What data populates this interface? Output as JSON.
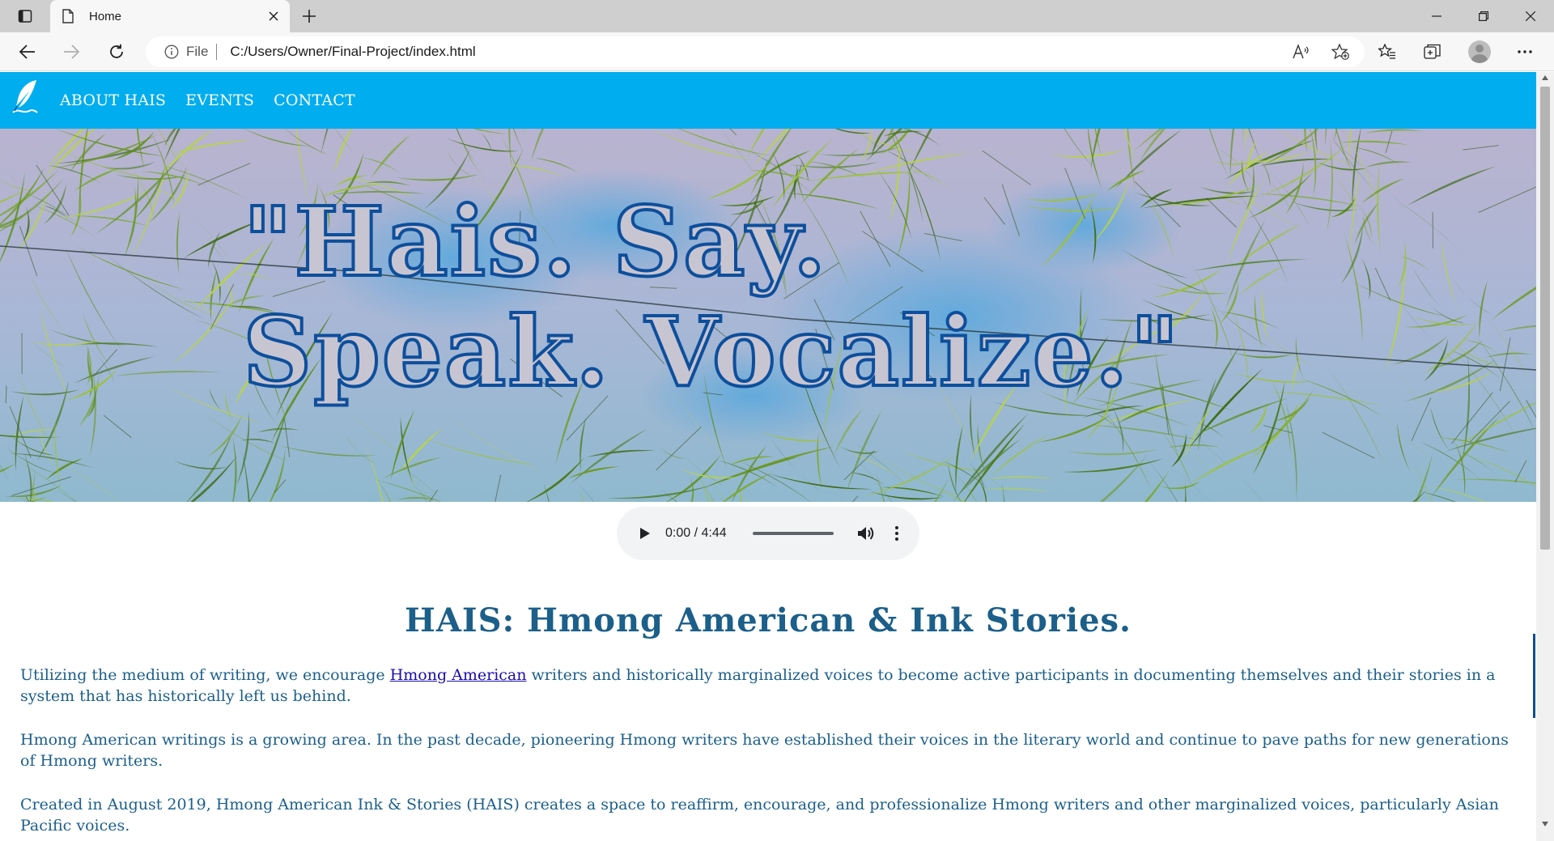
{
  "browser": {
    "tab": {
      "title": "Home"
    },
    "address": {
      "scheme_label": "File",
      "url": "C:/Users/Owner/Final-Project/index.html"
    }
  },
  "site": {
    "nav": {
      "items": [
        {
          "label": "ABOUT HAIS"
        },
        {
          "label": "EVENTS"
        },
        {
          "label": "CONTACT"
        }
      ]
    },
    "hero": {
      "quote": "\"Hais. Say.\nSpeak. Vocalize.\""
    },
    "audio": {
      "time": "0:00 / 4:44"
    },
    "heading": "HAIS: Hmong American & Ink Stories.",
    "paragraphs": {
      "p1_before": "Utilizing the medium of writing, we encourage ",
      "p1_link": "Hmong American",
      "p1_after": " writers and historically marginalized voices to become active participants in documenting themselves and their stories in a system that has historically left us behind.",
      "p2": "Hmong American writings is a growing area. In the past decade, pioneering Hmong writers have established their voices in the literary world and continue to pave paths for new generations of Hmong writers.",
      "p3": "Created in August 2019, Hmong American Ink & Stories (HAIS) creates a space to reaffirm, encourage, and professionalize Hmong writers and other marginalized voices, particularly Asian Pacific voices."
    }
  },
  "colors": {
    "nav_bg": "#00adef",
    "text_blue": "#1b5f8a",
    "link": "#1a0dab",
    "quote_stroke": "#0d4f9c"
  }
}
